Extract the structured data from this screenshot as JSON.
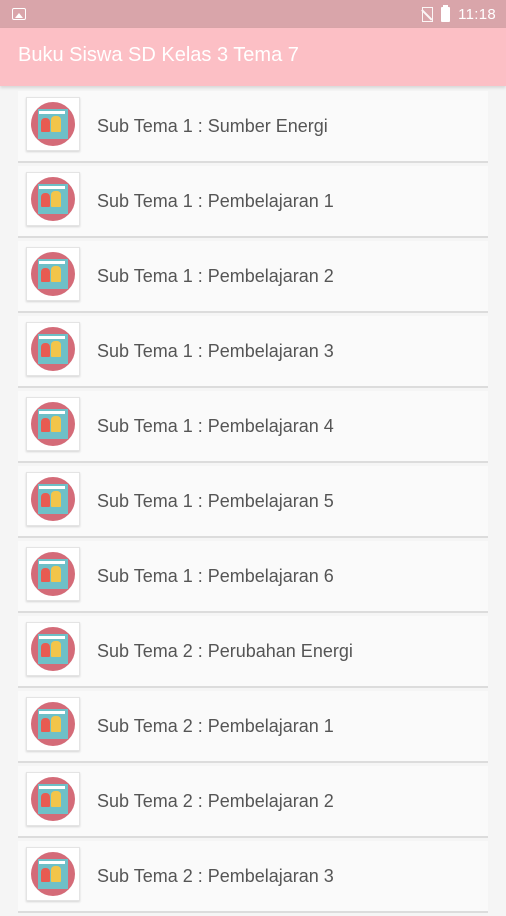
{
  "status_bar": {
    "time": "11:18"
  },
  "app_bar": {
    "title": "Buku Siswa SD Kelas 3 Tema 7"
  },
  "items": [
    {
      "label": "Sub Tema 1 : Sumber Energi",
      "icon": "book-cover-icon"
    },
    {
      "label": "Sub Tema 1 : Pembelajaran 1",
      "icon": "book-cover-icon"
    },
    {
      "label": "Sub Tema 1 : Pembelajaran 2",
      "icon": "book-cover-icon"
    },
    {
      "label": "Sub Tema 1 : Pembelajaran 3",
      "icon": "book-cover-icon"
    },
    {
      "label": "Sub Tema 1 : Pembelajaran 4",
      "icon": "book-cover-icon"
    },
    {
      "label": "Sub Tema 1 : Pembelajaran 5",
      "icon": "book-cover-icon"
    },
    {
      "label": "Sub Tema 1 : Pembelajaran 6",
      "icon": "book-cover-icon"
    },
    {
      "label": "Sub Tema 2 : Perubahan Energi",
      "icon": "book-cover-icon"
    },
    {
      "label": "Sub Tema 2 : Pembelajaran 1",
      "icon": "book-cover-icon"
    },
    {
      "label": "Sub Tema 2 : Pembelajaran 2",
      "icon": "book-cover-icon"
    },
    {
      "label": "Sub Tema 2 : Pembelajaran 3",
      "icon": "book-cover-icon"
    }
  ],
  "colors": {
    "status_bar": "#d9a5aa",
    "app_bar": "#fcbfc5",
    "background": "#f5f5f5"
  }
}
